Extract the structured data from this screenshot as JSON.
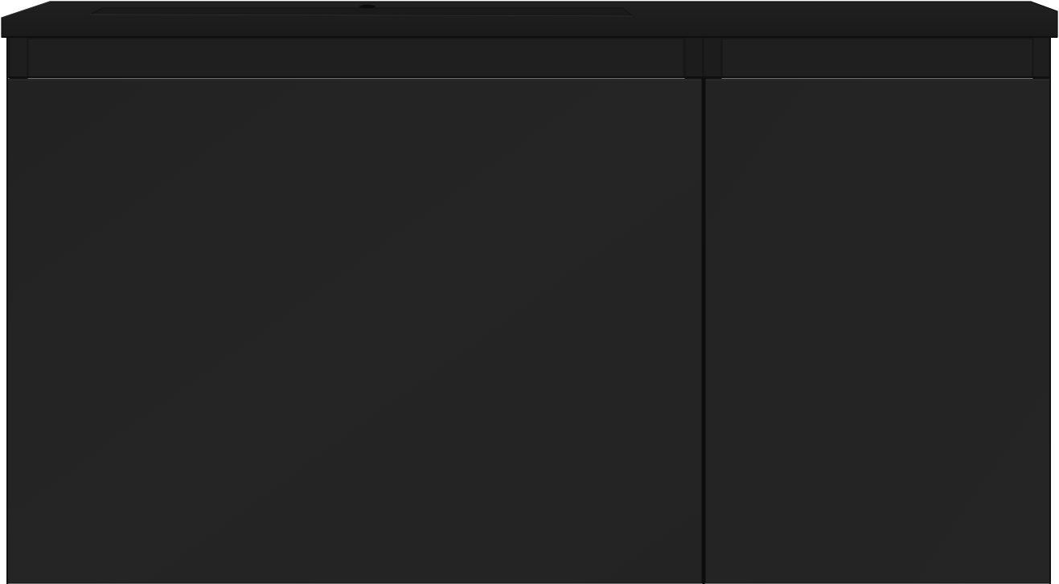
{
  "image": {
    "subject": "vanity-cabinet",
    "colors": {
      "background": "#ffffff",
      "countertop": "#1e1e1e",
      "countertop_edge": "#181818",
      "basin_recess": "#1a1a1a",
      "rail": "#1c1c1c",
      "door_main": "#242424",
      "door_dark": "#1f1f1f",
      "seam": "#0f0f0f",
      "highlight": "#3a3a3a"
    },
    "elements": [
      "countertop",
      "basin",
      "drain-hole",
      "top-rail",
      "left-door",
      "right-door"
    ]
  }
}
